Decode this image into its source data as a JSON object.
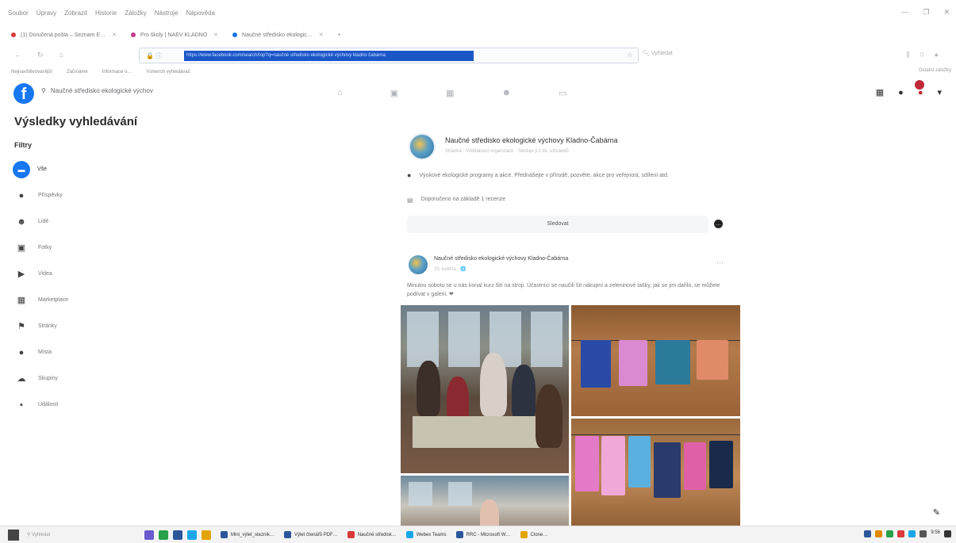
{
  "browser": {
    "menu": [
      "Soubor",
      "Úpravy",
      "Zobrazit",
      "Historie",
      "Záložky",
      "Nástroje",
      "Nápověda"
    ],
    "window_controls": [
      "—",
      "❐",
      "✕"
    ],
    "tabs": [
      {
        "label": "(1) Doručená pošta – Seznam E…",
        "color": "#d93a3a"
      },
      {
        "label": "Pro školy | NAEV KLADNO",
        "color": "#c23a8a"
      },
      {
        "label": "Naučné středisko ekologic…",
        "color": "#1877f2"
      }
    ],
    "new_tab": "+",
    "url_selected": "https://www.facebook.com/search/top?q=naučné středisko ekologické výchovy kladno čabarna",
    "search_placeholder": "Vyhledat",
    "bookmarks": [
      "Nejnavštěvovanější",
      "Začínáme",
      "Informace o…",
      "Vsmerch vyhledávač"
    ],
    "bookmarks_right": "Ostatní záložky"
  },
  "fb": {
    "logo": "f",
    "search_value": "Naučné středisko ekologické výchov",
    "nav_icons": [
      "⌂",
      "▣",
      "▦",
      "☻",
      "▭"
    ],
    "right_icons": [
      "▦",
      "●",
      "●",
      "▾"
    ]
  },
  "sidebar": {
    "title": "Výsledky vyhledávání",
    "filters_label": "Filtry",
    "items": [
      {
        "label": "Vše",
        "icon": "▬"
      },
      {
        "label": "Příspěvky",
        "icon": "●"
      },
      {
        "label": "Lidé",
        "icon": "☻"
      },
      {
        "label": "Fotky",
        "icon": "▣"
      },
      {
        "label": "Videa",
        "icon": "▶"
      },
      {
        "label": "Marketplace",
        "icon": "▦"
      },
      {
        "label": "Stránky",
        "icon": "⚑"
      },
      {
        "label": "Místa",
        "icon": "●"
      },
      {
        "label": "Skupiny",
        "icon": "☁"
      },
      {
        "label": "Události",
        "icon": "▪"
      }
    ]
  },
  "page_card": {
    "title": "Naučné středisko ekologické výchovy Kladno-Čabárna",
    "subtitle": "Stránka · Vzdělávací organizace · Sleduje ji 1 tis. uživatelů",
    "info": "Výukové ekologické programy a akce. Přednášejte v přírodě, pozvěte, akce pro veřejnost, sdílení atd.",
    "recommend": "Doporučeno na základě 1 recenze",
    "follow_label": "Sledovat",
    "more": "•••"
  },
  "post": {
    "author": "Naučné středisko ekologické výchovy Kladno-Čabárna",
    "date": "20. května · 🌐",
    "dots": "···",
    "text": "Minulou sobotu se u nás konal kurz šití na stroji. Účastníci se naučili šít nákupní a zeleninové tašky, jak se jim dařilo, se můžete podívat v galerii. ❤"
  },
  "edit_icon": "✎",
  "taskbar": {
    "search": "Vyhledat",
    "apps": [
      {
        "label": "Mini_výlet_stezník…",
        "color": "#2b579a"
      },
      {
        "label": "Výlet čtenářů PDF…",
        "color": "#2b579a"
      },
      {
        "label": "Naučné středisk…",
        "color": "#d93a3a"
      },
      {
        "label": "Webex Teams",
        "color": "#1aa7e8"
      },
      {
        "label": "RRC - Microsoft W…",
        "color": "#2b579a"
      },
      {
        "label": "Clone…",
        "color": "#e2a400"
      }
    ],
    "time": "9:56"
  }
}
